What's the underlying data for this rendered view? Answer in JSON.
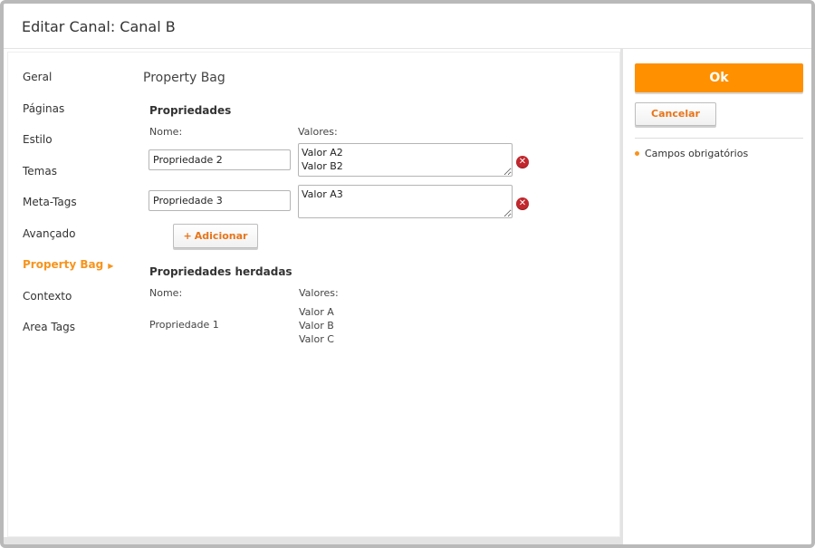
{
  "header": {
    "title": "Editar Canal: Canal B"
  },
  "sidebar": {
    "items": [
      {
        "label": "Geral"
      },
      {
        "label": "Páginas"
      },
      {
        "label": "Estilo"
      },
      {
        "label": "Temas"
      },
      {
        "label": "Meta-Tags"
      },
      {
        "label": "Avançado"
      },
      {
        "label": "Property Bag",
        "active": true
      },
      {
        "label": "Contexto"
      },
      {
        "label": "Area Tags"
      }
    ]
  },
  "main": {
    "section_title": "Property Bag",
    "properties": {
      "heading": "Propriedades",
      "name_header": "Nome:",
      "values_header": "Valores:",
      "rows": [
        {
          "name": "Propriedade 2",
          "values": "Valor A2\nValor B2"
        },
        {
          "name": "Propriedade 3",
          "values": "Valor A3"
        }
      ],
      "add_label": "Adicionar",
      "add_icon": "plus-icon"
    },
    "inherited": {
      "heading": "Propriedades herdadas",
      "name_header": "Nome:",
      "values_header": "Valores:",
      "rows": [
        {
          "name": "Propriedade 1",
          "values": [
            "Valor A",
            "Valor B",
            "Valor C"
          ]
        }
      ]
    }
  },
  "panel": {
    "ok_label": "Ok",
    "cancel_label": "Cancelar",
    "required_note": "Campos obrigatórios"
  },
  "colors": {
    "accent": "#f7941d",
    "ok_button": "#ff9000",
    "remove_icon": "#c1272d"
  }
}
